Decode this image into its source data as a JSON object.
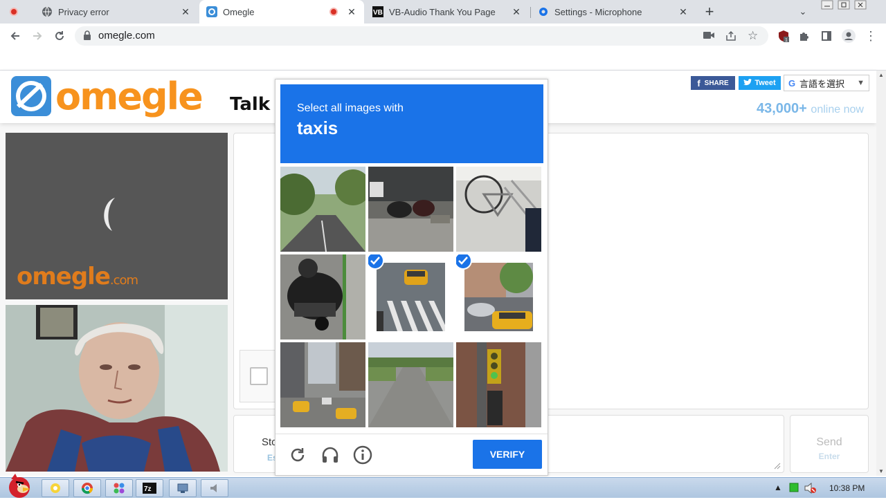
{
  "browser": {
    "tabs": [
      {
        "title": "Privacy error",
        "icon": "globe-icon",
        "active": false
      },
      {
        "title": "Omegle",
        "icon": "omegle-icon",
        "active": true
      },
      {
        "title": "VB-Audio Thank You Page",
        "icon": "vb-icon",
        "active": false
      },
      {
        "title": "Settings - Microphone",
        "icon": "gear-icon",
        "active": false
      }
    ],
    "url": "omegle.com"
  },
  "omegle": {
    "logo_text": "omegle",
    "tagline": "Talk t",
    "share_fb": "SHARE",
    "share_tw": "Tweet",
    "translate_label": "言語を選択",
    "online_count": "43,000+",
    "online_label": "online now",
    "video_watermark": "omegle",
    "video_watermark_suffix": ".com",
    "stop_label": "Sto",
    "stop_key": "Es",
    "send_label": "Send",
    "send_key": "Enter"
  },
  "captcha": {
    "instruction": "Select all images with",
    "target": "taxis",
    "tiles": [
      {
        "name": "tile-road-trees",
        "selected": false
      },
      {
        "name": "tile-motorcycles-parked",
        "selected": false
      },
      {
        "name": "tile-bicycle",
        "selected": false
      },
      {
        "name": "tile-motorcycle-rider",
        "selected": false
      },
      {
        "name": "tile-crosswalk-taxi",
        "selected": true
      },
      {
        "name": "tile-street-taxi",
        "selected": true
      },
      {
        "name": "tile-city-traffic",
        "selected": false
      },
      {
        "name": "tile-empty-road",
        "selected": false
      },
      {
        "name": "tile-traffic-light",
        "selected": false
      }
    ],
    "verify_label": "VERIFY"
  },
  "taskbar": {
    "clock": "10:38 PM",
    "items": [
      "explorer",
      "chrome",
      "app-grid",
      "7z",
      "network",
      "audio"
    ]
  },
  "colors": {
    "captcha_blue": "#1a73e8",
    "omegle_orange": "#f7931e",
    "online_blue": "#7ab7e8"
  }
}
